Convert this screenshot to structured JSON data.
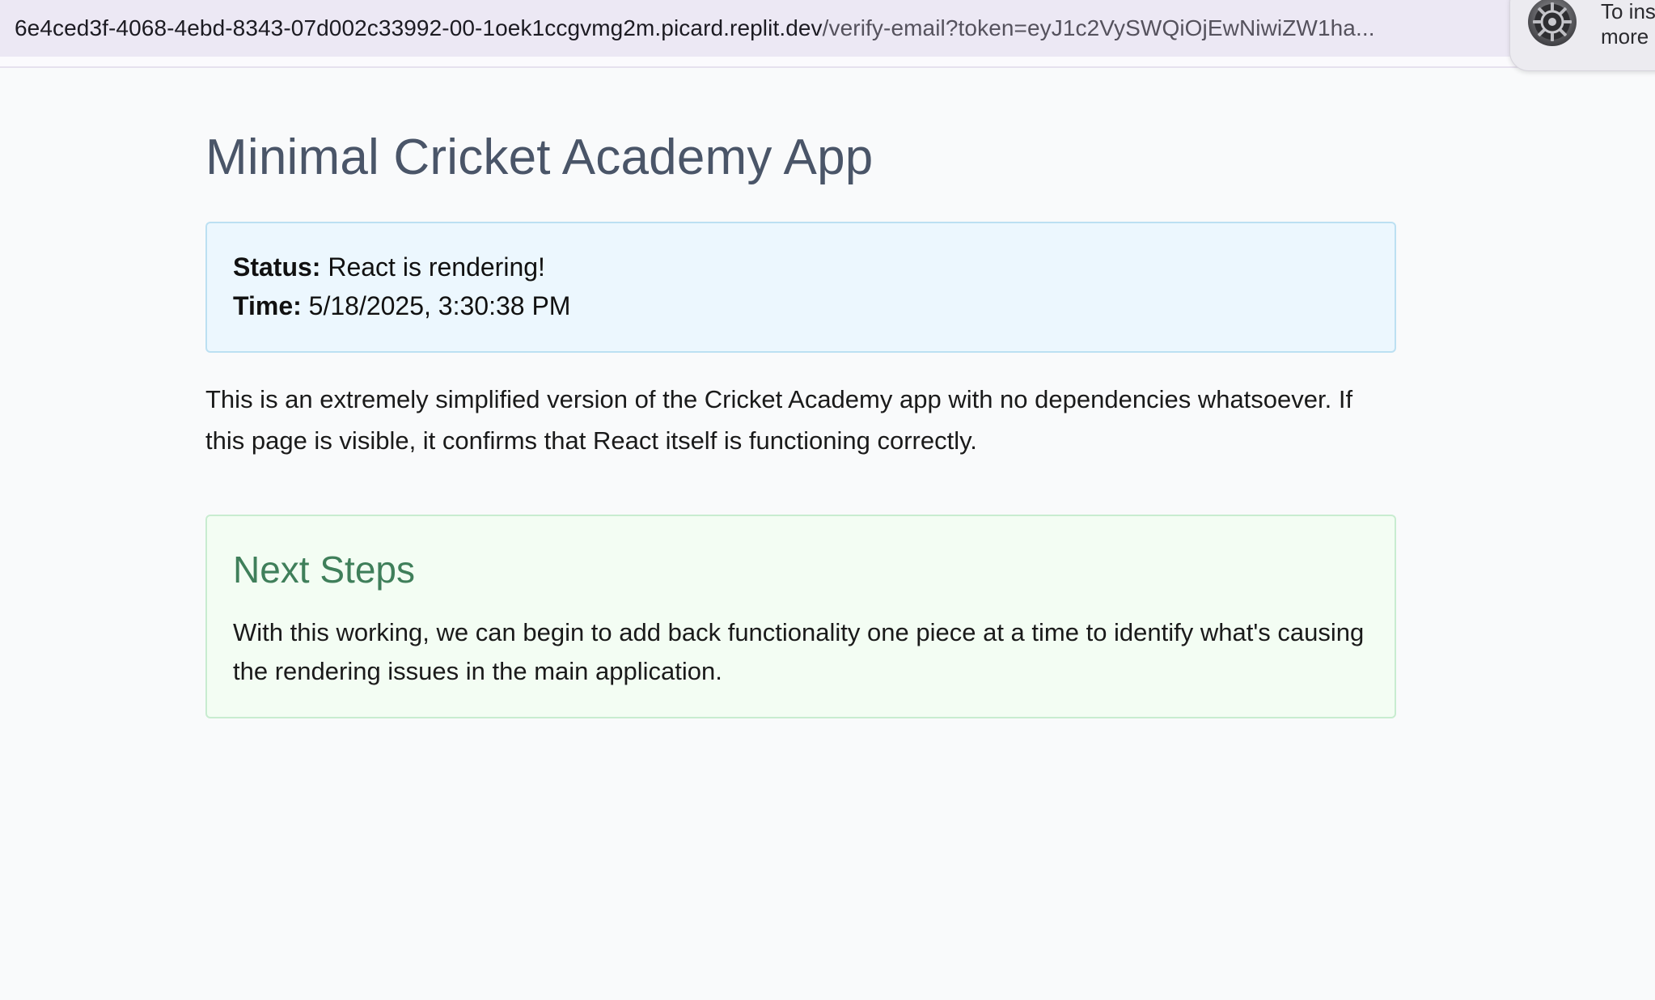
{
  "browser": {
    "url_host": "6e4ced3f-4068-4ebd-8343-07d002c33992-00-1oek1ccgvmg2m.picard.replit.dev",
    "url_path": "/verify-email?token=eyJ1c2VySWQiOjEwNiwiZW1ha...",
    "notification": {
      "line1": "To ins",
      "line2": "more",
      "icon": "settings-gear-icon"
    }
  },
  "page": {
    "title": "Minimal Cricket Academy App",
    "status_label": "Status:",
    "status_value": "React is rendering!",
    "time_label": "Time:",
    "time_value": "5/18/2025, 3:30:38 PM",
    "description": "This is an extremely simplified version of the Cricket Academy app with no dependencies whatsoever. If this page is visible, it confirms that React itself is functioning correctly.",
    "next_steps": {
      "title": "Next Steps",
      "text": "With this working, we can begin to add back functionality one piece at a time to identify what's causing the rendering issues in the main application."
    }
  },
  "colors": {
    "title": "#4a5568",
    "status_bg": "#ecf7fe",
    "status_border": "#bce0f2",
    "next_bg": "#f3fdf3",
    "next_border": "#c8ecd0",
    "next_title": "#3f7f5a"
  }
}
